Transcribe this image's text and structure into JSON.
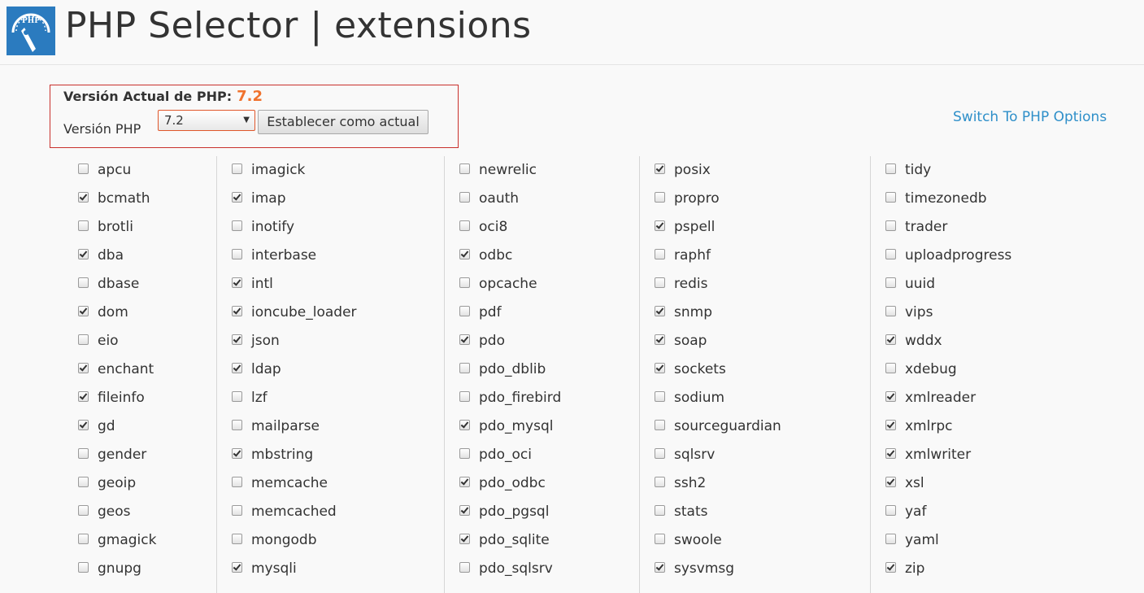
{
  "header": {
    "title": "PHP Selector | extensions",
    "logo_text": "PHP",
    "logo_icon": "speedometer-php-icon",
    "accent_color": "#2b7bbf"
  },
  "version": {
    "current_label": "Versión Actual de PHP:",
    "current_value": "7.2",
    "select_label": "Versión PHP",
    "selected": "7.2",
    "set_button": "Establecer como actual",
    "highlight_color": "#f0722d"
  },
  "switch_link": "Switch To PHP Options",
  "extensions": [
    [
      {
        "name": "apcu",
        "checked": false
      },
      {
        "name": "bcmath",
        "checked": true
      },
      {
        "name": "brotli",
        "checked": false
      },
      {
        "name": "dba",
        "checked": true
      },
      {
        "name": "dbase",
        "checked": false
      },
      {
        "name": "dom",
        "checked": true
      },
      {
        "name": "eio",
        "checked": false
      },
      {
        "name": "enchant",
        "checked": true
      },
      {
        "name": "fileinfo",
        "checked": true
      },
      {
        "name": "gd",
        "checked": true
      },
      {
        "name": "gender",
        "checked": false
      },
      {
        "name": "geoip",
        "checked": false
      },
      {
        "name": "geos",
        "checked": false
      },
      {
        "name": "gmagick",
        "checked": false
      },
      {
        "name": "gnupg",
        "checked": false
      }
    ],
    [
      {
        "name": "imagick",
        "checked": false
      },
      {
        "name": "imap",
        "checked": true
      },
      {
        "name": "inotify",
        "checked": false
      },
      {
        "name": "interbase",
        "checked": false
      },
      {
        "name": "intl",
        "checked": true
      },
      {
        "name": "ioncube_loader",
        "checked": true
      },
      {
        "name": "json",
        "checked": true
      },
      {
        "name": "ldap",
        "checked": true
      },
      {
        "name": "lzf",
        "checked": false
      },
      {
        "name": "mailparse",
        "checked": false
      },
      {
        "name": "mbstring",
        "checked": true
      },
      {
        "name": "memcache",
        "checked": false
      },
      {
        "name": "memcached",
        "checked": false
      },
      {
        "name": "mongodb",
        "checked": false
      },
      {
        "name": "mysqli",
        "checked": true
      }
    ],
    [
      {
        "name": "newrelic",
        "checked": false
      },
      {
        "name": "oauth",
        "checked": false
      },
      {
        "name": "oci8",
        "checked": false
      },
      {
        "name": "odbc",
        "checked": true
      },
      {
        "name": "opcache",
        "checked": false
      },
      {
        "name": "pdf",
        "checked": false
      },
      {
        "name": "pdo",
        "checked": true
      },
      {
        "name": "pdo_dblib",
        "checked": false
      },
      {
        "name": "pdo_firebird",
        "checked": false
      },
      {
        "name": "pdo_mysql",
        "checked": true
      },
      {
        "name": "pdo_oci",
        "checked": false
      },
      {
        "name": "pdo_odbc",
        "checked": true
      },
      {
        "name": "pdo_pgsql",
        "checked": true
      },
      {
        "name": "pdo_sqlite",
        "checked": true
      },
      {
        "name": "pdo_sqlsrv",
        "checked": false
      }
    ],
    [
      {
        "name": "posix",
        "checked": true
      },
      {
        "name": "propro",
        "checked": false
      },
      {
        "name": "pspell",
        "checked": true
      },
      {
        "name": "raphf",
        "checked": false
      },
      {
        "name": "redis",
        "checked": false
      },
      {
        "name": "snmp",
        "checked": true
      },
      {
        "name": "soap",
        "checked": true
      },
      {
        "name": "sockets",
        "checked": true
      },
      {
        "name": "sodium",
        "checked": false
      },
      {
        "name": "sourceguardian",
        "checked": false
      },
      {
        "name": "sqlsrv",
        "checked": false
      },
      {
        "name": "ssh2",
        "checked": false
      },
      {
        "name": "stats",
        "checked": false
      },
      {
        "name": "swoole",
        "checked": false
      },
      {
        "name": "sysvmsg",
        "checked": true
      }
    ],
    [
      {
        "name": "tidy",
        "checked": false
      },
      {
        "name": "timezonedb",
        "checked": false
      },
      {
        "name": "trader",
        "checked": false
      },
      {
        "name": "uploadprogress",
        "checked": false
      },
      {
        "name": "uuid",
        "checked": false
      },
      {
        "name": "vips",
        "checked": false
      },
      {
        "name": "wddx",
        "checked": true
      },
      {
        "name": "xdebug",
        "checked": false
      },
      {
        "name": "xmlreader",
        "checked": true
      },
      {
        "name": "xmlrpc",
        "checked": true
      },
      {
        "name": "xmlwriter",
        "checked": true
      },
      {
        "name": "xsl",
        "checked": true
      },
      {
        "name": "yaf",
        "checked": false
      },
      {
        "name": "yaml",
        "checked": false
      },
      {
        "name": "zip",
        "checked": true
      }
    ]
  ]
}
